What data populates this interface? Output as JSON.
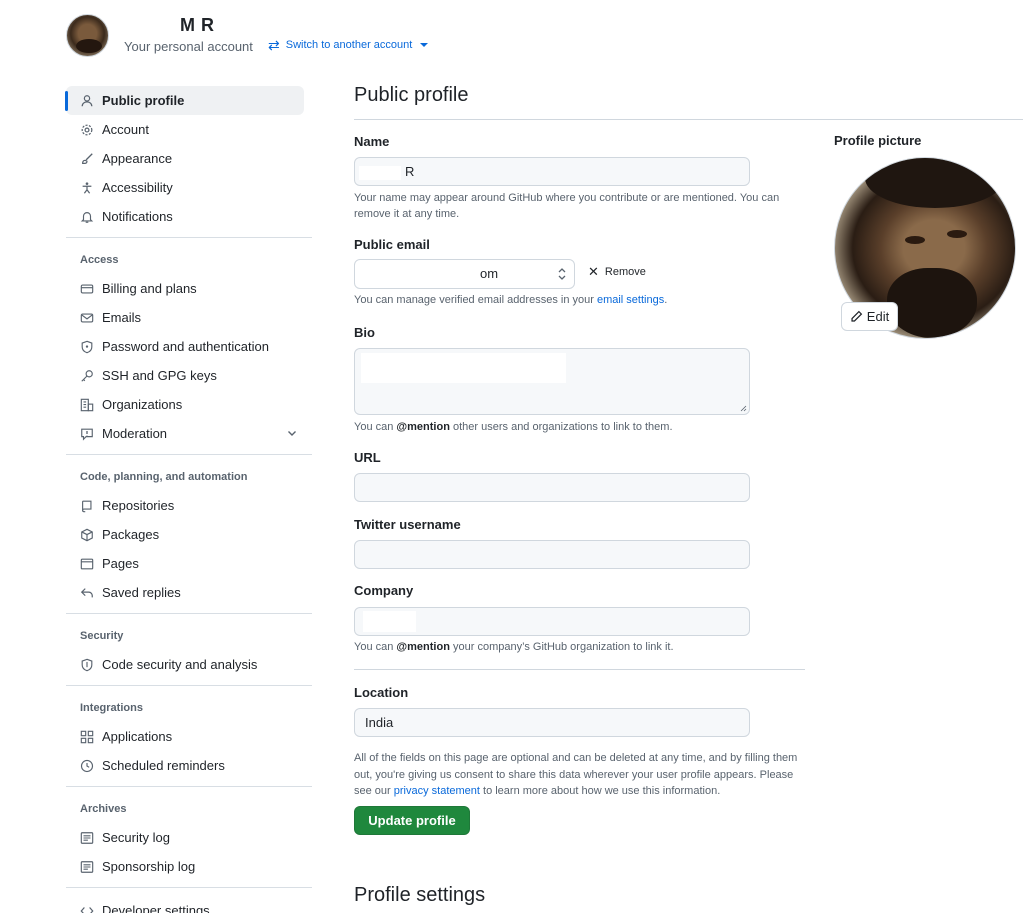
{
  "header": {
    "account_name": "M R",
    "account_subtitle": "Your personal account",
    "switch_label": "Switch to another account"
  },
  "sidebar": {
    "items_top": [
      {
        "label": "Public profile",
        "icon": "person-icon",
        "active": true
      },
      {
        "label": "Account",
        "icon": "gear-icon"
      },
      {
        "label": "Appearance",
        "icon": "paintbrush-icon"
      },
      {
        "label": "Accessibility",
        "icon": "accessibility-icon"
      },
      {
        "label": "Notifications",
        "icon": "bell-icon"
      }
    ],
    "access": {
      "title": "Access",
      "items": [
        {
          "label": "Billing and plans",
          "icon": "credit-card-icon"
        },
        {
          "label": "Emails",
          "icon": "mail-icon"
        },
        {
          "label": "Password and authentication",
          "icon": "shield-lock-icon"
        },
        {
          "label": "SSH and GPG keys",
          "icon": "key-icon"
        },
        {
          "label": "Organizations",
          "icon": "organization-icon"
        },
        {
          "label": "Moderation",
          "icon": "report-icon"
        }
      ]
    },
    "code": {
      "title": "Code, planning, and automation",
      "items": [
        {
          "label": "Repositories",
          "icon": "repo-icon"
        },
        {
          "label": "Packages",
          "icon": "package-icon"
        },
        {
          "label": "Pages",
          "icon": "browser-icon"
        },
        {
          "label": "Saved replies",
          "icon": "reply-icon"
        }
      ]
    },
    "security": {
      "title": "Security",
      "items": [
        {
          "label": "Code security and analysis",
          "icon": "shield-icon"
        }
      ]
    },
    "integrations": {
      "title": "Integrations",
      "items": [
        {
          "label": "Applications",
          "icon": "apps-icon"
        },
        {
          "label": "Scheduled reminders",
          "icon": "clock-icon"
        }
      ]
    },
    "archives": {
      "title": "Archives",
      "items": [
        {
          "label": "Security log",
          "icon": "log-icon"
        },
        {
          "label": "Sponsorship log",
          "icon": "log-icon"
        }
      ]
    },
    "developer": {
      "label": "Developer settings",
      "icon": "code-icon"
    }
  },
  "main": {
    "title": "Public profile",
    "name": {
      "label": "Name",
      "value": "R",
      "hint": "Your name may appear around GitHub where you contribute or are mentioned. You can remove it at any time."
    },
    "public_email": {
      "label": "Public email",
      "value": "om",
      "remove_label": "Remove",
      "hint_prefix": "You can manage verified email addresses in your ",
      "hint_link": "email settings",
      "hint_suffix": "."
    },
    "bio": {
      "label": "Bio",
      "hint_prefix": "You can ",
      "hint_bold": "@mention",
      "hint_suffix": " other users and organizations to link to them."
    },
    "url": {
      "label": "URL",
      "value": ""
    },
    "twitter": {
      "label": "Twitter username",
      "value": ""
    },
    "company": {
      "label": "Company",
      "value": "",
      "hint_prefix": "You can ",
      "hint_bold": "@mention",
      "hint_suffix": " your company’s GitHub organization to link it."
    },
    "location": {
      "label": "Location",
      "value": "India"
    },
    "note": {
      "part1": "All of the fields on this page are optional and can be deleted at any time, and by filling them out, you're giving us consent to share this data wherever your user profile appears. Please see our ",
      "link": "privacy statement",
      "part2": " to learn more about how we use this information."
    },
    "update_button": "Update profile",
    "settings_title": "Profile settings"
  },
  "profile_picture": {
    "label": "Profile picture",
    "edit_label": "Edit"
  },
  "colors": {
    "accent": "#0969da",
    "primary_button": "#1f883d",
    "field_bg": "#f6f8fa",
    "border": "#d0d7de"
  }
}
